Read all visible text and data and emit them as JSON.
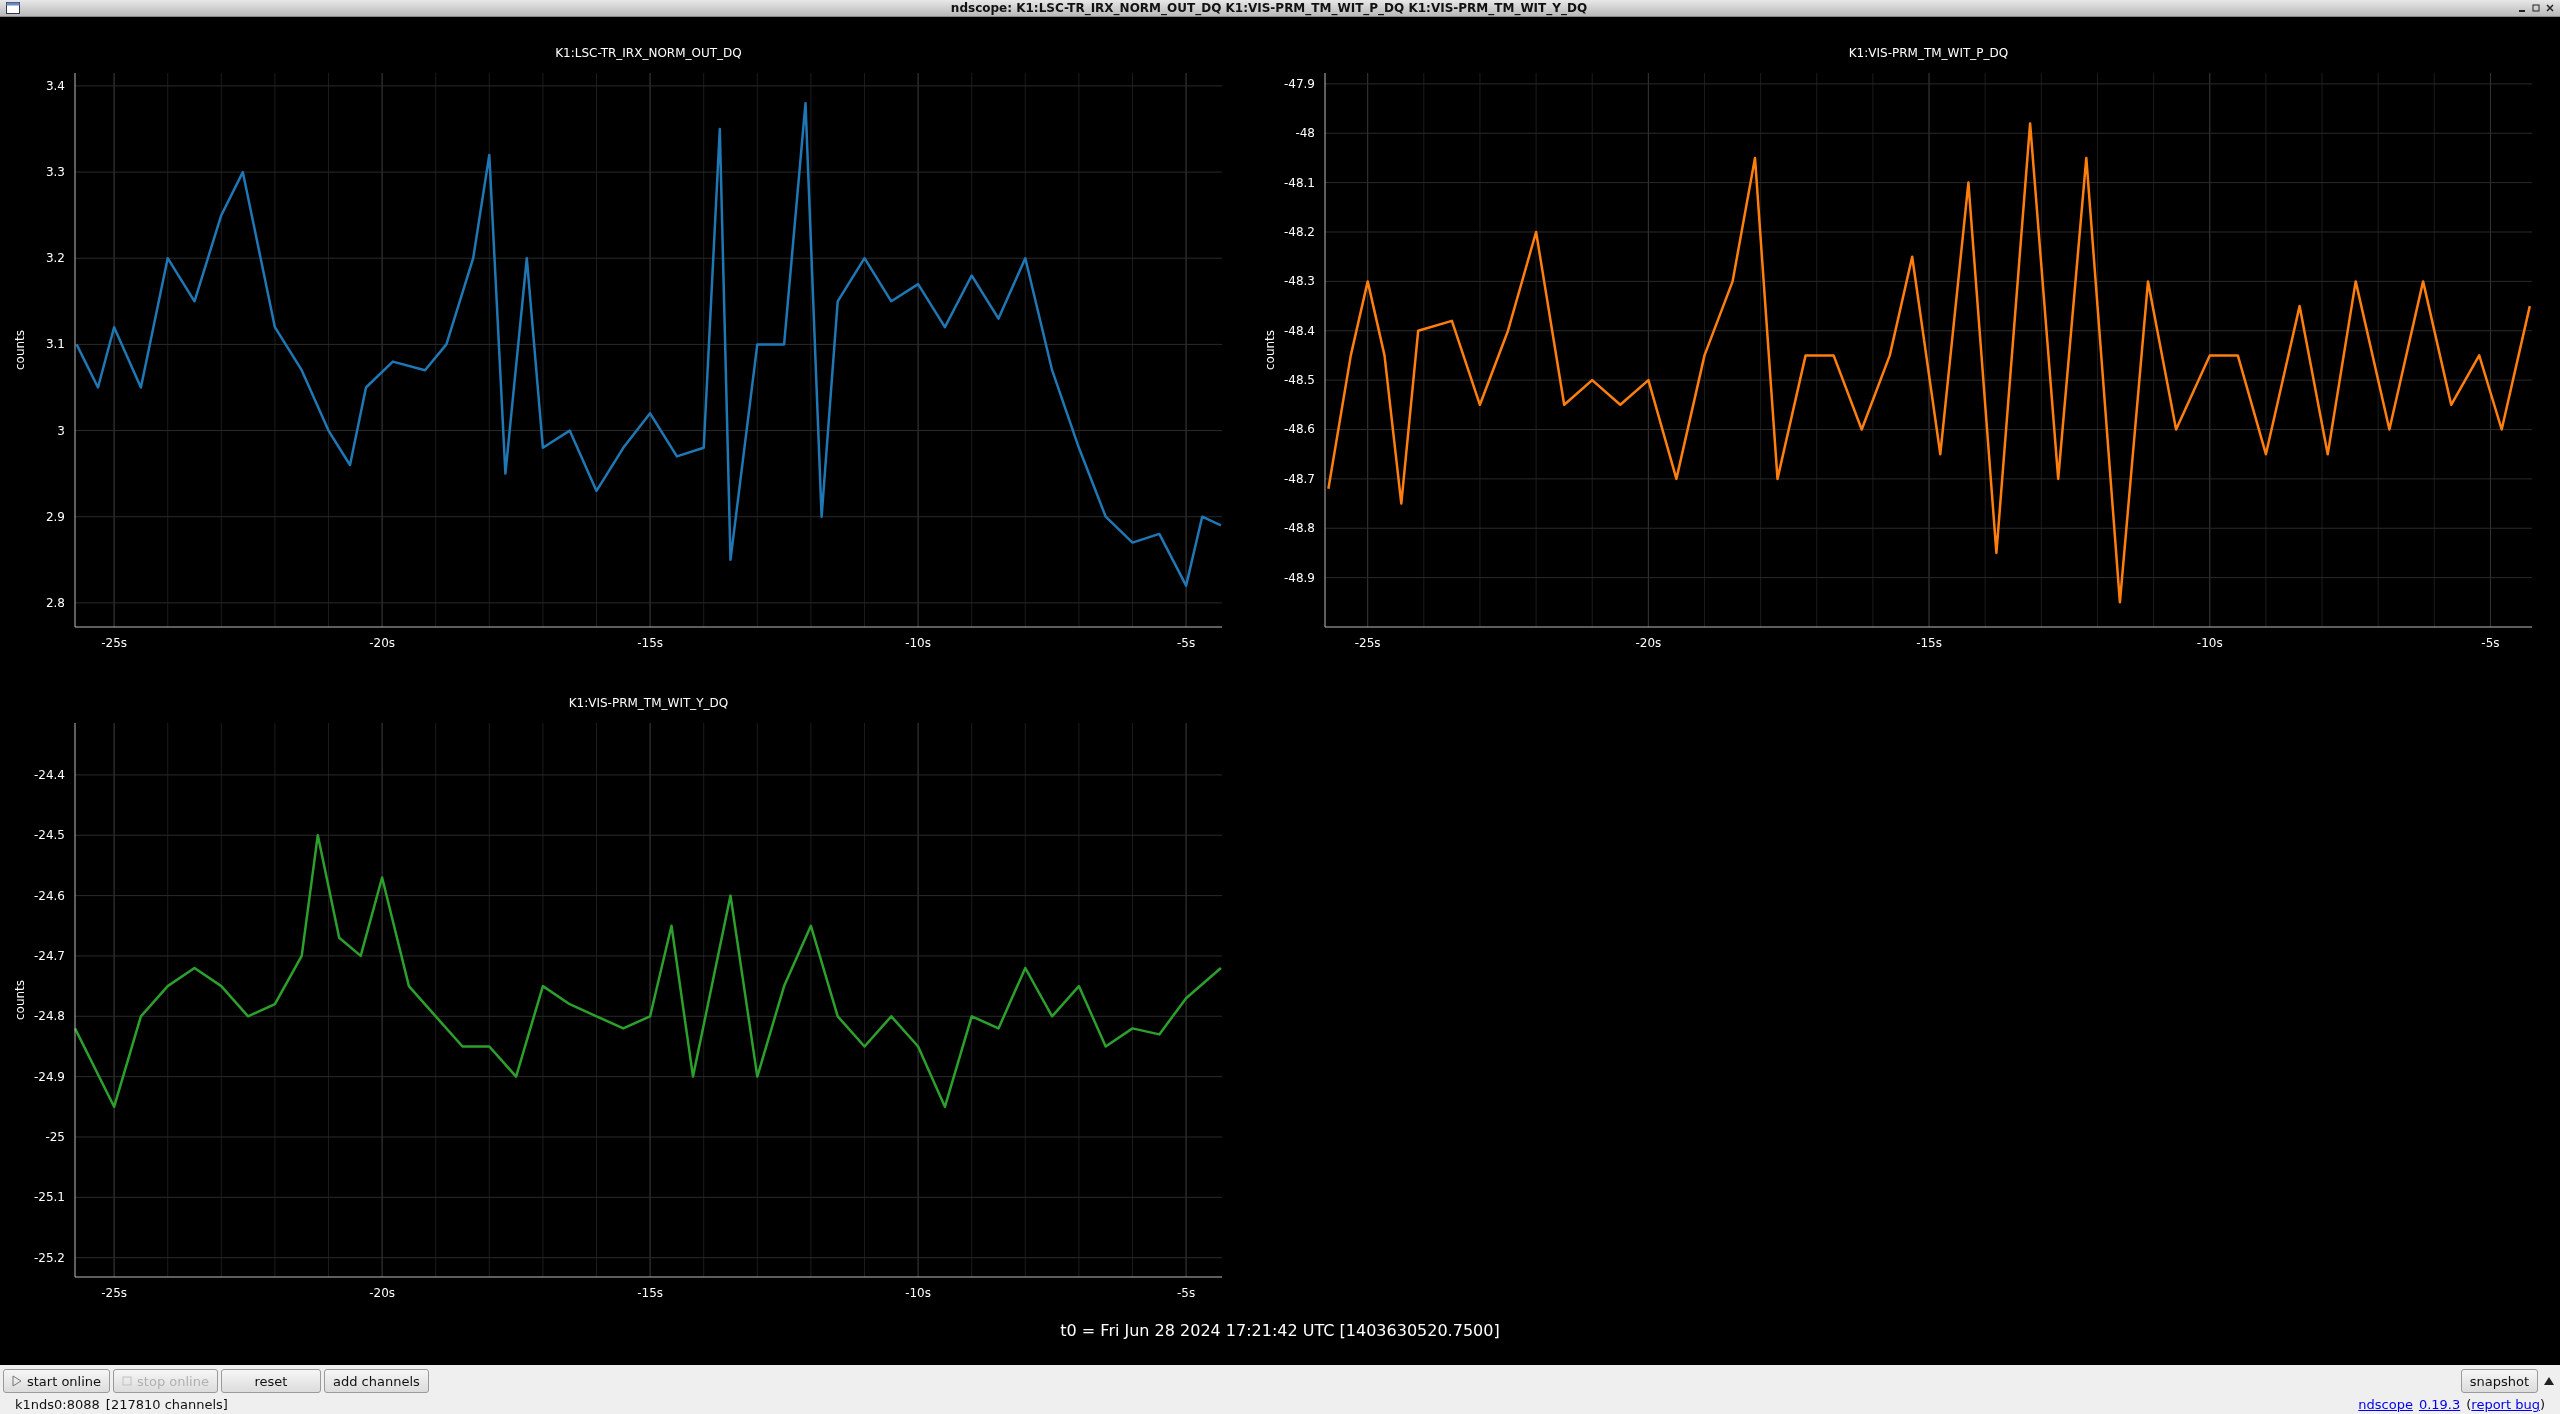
{
  "window": {
    "title": "ndscope: K1:LSC-TR_IRX_NORM_OUT_DQ K1:VIS-PRM_TM_WIT_P_DQ K1:VIS-PRM_TM_WIT_Y_DQ"
  },
  "plots": [
    {
      "title": "K1:LSC-TR_IRX_NORM_OUT_DQ",
      "chart_data": {
        "type": "line",
        "ylabel": "counts",
        "xlim": [
          -25.73,
          -4.33
        ],
        "ylim": [
          2.772,
          3.415
        ],
        "xticks": [
          {
            "value": -25,
            "label": "-25s"
          },
          {
            "value": -20,
            "label": "-20s"
          },
          {
            "value": -15,
            "label": "-15s"
          },
          {
            "value": -10,
            "label": "-10s"
          },
          {
            "value": -5,
            "label": "-5s"
          }
        ],
        "yticks": [
          2.8,
          2.9,
          3,
          3.1,
          3.2,
          3.3,
          3.4
        ],
        "x": [
          -25.7,
          -25.3,
          -25,
          -24.5,
          -24,
          -23.5,
          -23,
          -22.6,
          -22,
          -21.5,
          -21,
          -20.6,
          -20.3,
          -19.8,
          -19.2,
          -18.8,
          -18.3,
          -18,
          -17.7,
          -17.3,
          -17,
          -16.5,
          -16,
          -15.5,
          -15,
          -14.5,
          -14,
          -13.7,
          -13.5,
          -13,
          -12.5,
          -12.1,
          -11.8,
          -11.5,
          -11,
          -10.5,
          -10,
          -9.5,
          -9,
          -8.5,
          -8,
          -7.5,
          -7,
          -6.5,
          -6,
          -5.5,
          -5,
          -4.7,
          -4.35
        ],
        "grid": true,
        "series": [
          {
            "color": "#1f77b4",
            "values": [
              3.1,
              3.05,
              3.12,
              3.05,
              3.2,
              3.15,
              3.25,
              3.3,
              3.12,
              3.07,
              3.0,
              2.96,
              3.05,
              3.08,
              3.07,
              3.1,
              3.2,
              3.32,
              2.95,
              3.2,
              2.98,
              3.0,
              2.93,
              2.98,
              3.02,
              2.97,
              2.98,
              3.35,
              2.85,
              3.1,
              3.1,
              3.38,
              2.9,
              3.15,
              3.2,
              3.15,
              3.17,
              3.12,
              3.18,
              3.13,
              3.2,
              3.07,
              2.98,
              2.9,
              2.87,
              2.88,
              2.82,
              2.9,
              2.89
            ]
          }
        ]
      }
    },
    {
      "title": "K1:VIS-PRM_TM_WIT_P_DQ",
      "chart_data": {
        "type": "line",
        "ylabel": "counts",
        "xlim": [
          -25.76,
          -4.26
        ],
        "ylim": [
          -49.0,
          -47.878
        ],
        "xticks": [
          {
            "value": -25,
            "label": "-25s"
          },
          {
            "value": -20,
            "label": "-20s"
          },
          {
            "value": -15,
            "label": "-15s"
          },
          {
            "value": -10,
            "label": "-10s"
          },
          {
            "value": -5,
            "label": "-5s"
          }
        ],
        "yticks": [
          -48.9,
          -48.8,
          -48.7,
          -48.6,
          -48.5,
          -48.4,
          -48.3,
          -48.2,
          -48.1,
          -48,
          -47.9
        ],
        "x": [
          -25.7,
          -25.3,
          -25,
          -24.7,
          -24.4,
          -24.1,
          -23.5,
          -23,
          -22.5,
          -22,
          -21.5,
          -21,
          -20.5,
          -20,
          -19.5,
          -19,
          -18.5,
          -18.1,
          -17.7,
          -17.2,
          -16.7,
          -16.2,
          -15.7,
          -15.3,
          -14.8,
          -14.3,
          -13.8,
          -13.2,
          -12.7,
          -12.2,
          -11.6,
          -11.1,
          -10.6,
          -10,
          -9.5,
          -9,
          -8.4,
          -7.9,
          -7.4,
          -6.8,
          -6.2,
          -5.7,
          -5.2,
          -4.8,
          -4.3
        ],
        "grid": true,
        "series": [
          {
            "color": "#ff7f0e",
            "values": [
              -48.72,
              -48.45,
              -48.3,
              -48.45,
              -48.75,
              -48.4,
              -48.38,
              -48.55,
              -48.4,
              -48.2,
              -48.55,
              -48.5,
              -48.55,
              -48.5,
              -48.7,
              -48.45,
              -48.3,
              -48.05,
              -48.7,
              -48.45,
              -48.45,
              -48.6,
              -48.45,
              -48.25,
              -48.65,
              -48.1,
              -48.85,
              -47.98,
              -48.7,
              -48.05,
              -48.95,
              -48.3,
              -48.6,
              -48.45,
              -48.45,
              -48.65,
              -48.35,
              -48.65,
              -48.3,
              -48.6,
              -48.3,
              -48.55,
              -48.45,
              -48.6,
              -48.35
            ]
          }
        ]
      }
    },
    {
      "title": "K1:VIS-PRM_TM_WIT_Y_DQ",
      "chart_data": {
        "type": "line",
        "ylabel": "counts",
        "xlim": [
          -25.73,
          -4.33
        ],
        "ylim": [
          -25.232,
          -24.314
        ],
        "xticks": [
          {
            "value": -25,
            "label": "-25s"
          },
          {
            "value": -20,
            "label": "-20s"
          },
          {
            "value": -15,
            "label": "-15s"
          },
          {
            "value": -10,
            "label": "-10s"
          },
          {
            "value": -5,
            "label": "-5s"
          }
        ],
        "yticks": [
          -25.2,
          -25.1,
          -25,
          -24.9,
          -24.8,
          -24.7,
          -24.6,
          -24.5,
          -24.4
        ],
        "x": [
          -25.73,
          -25,
          -24.5,
          -24,
          -23.5,
          -23,
          -22.5,
          -22,
          -21.5,
          -21.2,
          -20.8,
          -20.4,
          -20,
          -19.5,
          -19,
          -18.5,
          -18,
          -17.5,
          -17,
          -16.5,
          -16,
          -15.5,
          -15,
          -14.6,
          -14.2,
          -13.5,
          -13,
          -12.5,
          -12,
          -11.5,
          -11,
          -10.5,
          -10,
          -9.5,
          -9,
          -8.5,
          -8,
          -7.5,
          -7,
          -6.5,
          -6,
          -5.5,
          -5,
          -4.35
        ],
        "grid": true,
        "series": [
          {
            "color": "#2ca02c",
            "values": [
              -24.82,
              -24.95,
              -24.8,
              -24.75,
              -24.72,
              -24.75,
              -24.8,
              -24.78,
              -24.7,
              -24.5,
              -24.67,
              -24.7,
              -24.57,
              -24.75,
              -24.8,
              -24.85,
              -24.85,
              -24.9,
              -24.75,
              -24.78,
              -24.8,
              -24.82,
              -24.8,
              -24.65,
              -24.9,
              -24.6,
              -24.9,
              -24.75,
              -24.65,
              -24.8,
              -24.85,
              -24.8,
              -24.85,
              -24.95,
              -24.8,
              -24.82,
              -24.72,
              -24.8,
              -24.75,
              -24.85,
              -24.82,
              -24.83,
              -24.77,
              -24.72
            ]
          }
        ]
      }
    }
  ],
  "t0": "t0 = Fri Jun 28 2024 17:21:42 UTC [1403630520.7500]",
  "buttons": [
    {
      "label": "start online",
      "kind": "play",
      "disabled": false
    },
    {
      "label": "stop online",
      "kind": "stop",
      "disabled": true
    },
    {
      "label": "reset",
      "kind": "plain",
      "disabled": false
    },
    {
      "label": "add channels",
      "kind": "plain",
      "disabled": false
    }
  ],
  "snapshot_button": "snapshot",
  "status": {
    "server": "k1nds0:8088",
    "channels": "[217810 channels]",
    "app_link": "ndscope",
    "version_link": "0.19.3",
    "open_paren": "(",
    "bug_link": "report bug",
    "close_paren": ")"
  }
}
